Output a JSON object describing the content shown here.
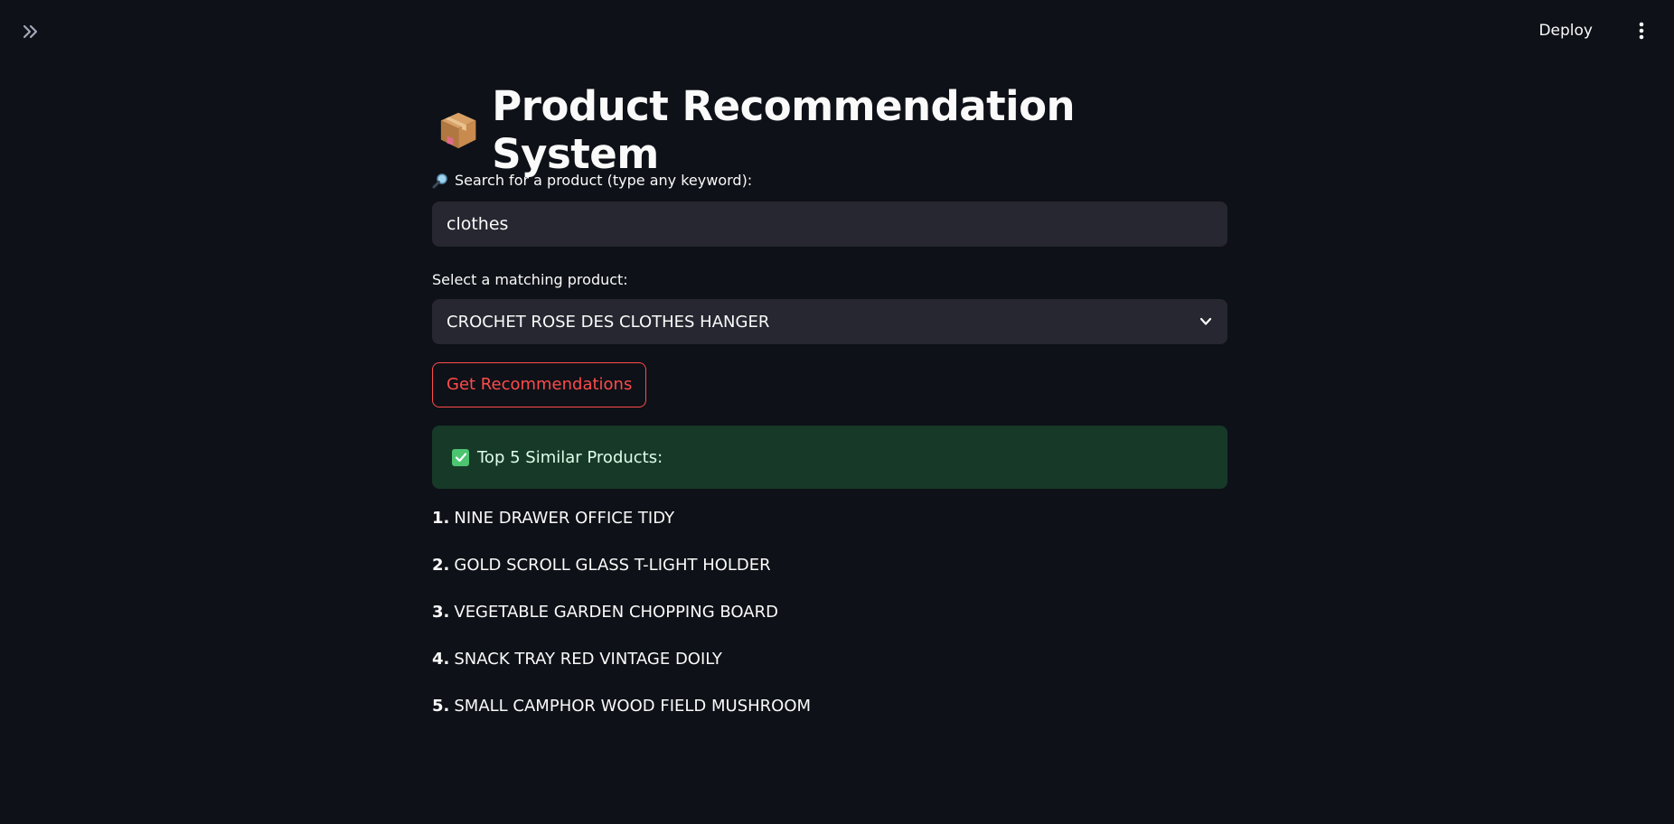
{
  "header": {
    "deploy_label": "Deploy"
  },
  "page": {
    "title": "Product Recommendation System"
  },
  "search": {
    "label": "Search for a product (type any keyword):",
    "value": "clothes"
  },
  "select": {
    "label": "Select a matching product:",
    "selected": "CROCHET ROSE DES CLOTHES HANGER"
  },
  "button": {
    "label": "Get Recommendations"
  },
  "success": {
    "message": "Top 5 Similar Products:"
  },
  "results": [
    {
      "num": "1.",
      "name": "NINE DRAWER OFFICE TIDY"
    },
    {
      "num": "2.",
      "name": "GOLD SCROLL GLASS T-LIGHT HOLDER"
    },
    {
      "num": "3.",
      "name": "VEGETABLE GARDEN CHOPPING BOARD"
    },
    {
      "num": "4.",
      "name": "SNACK TRAY RED VINTAGE DOILY"
    },
    {
      "num": "5.",
      "name": "SMALL CAMPHOR WOOD FIELD MUSHROOM"
    }
  ],
  "icons": {
    "sidebar_toggle": "double-chevron-right-icon",
    "menu": "vertical-dots-icon",
    "title": "package-icon",
    "search": "magnifying-glass-icon",
    "dropdown": "chevron-down-icon",
    "success": "check-mark-icon"
  },
  "colors": {
    "background": "#0e1117",
    "input_bg": "#262730",
    "accent": "#ff4b4b",
    "success_bg": "#173928",
    "success_check": "#4cc470"
  }
}
